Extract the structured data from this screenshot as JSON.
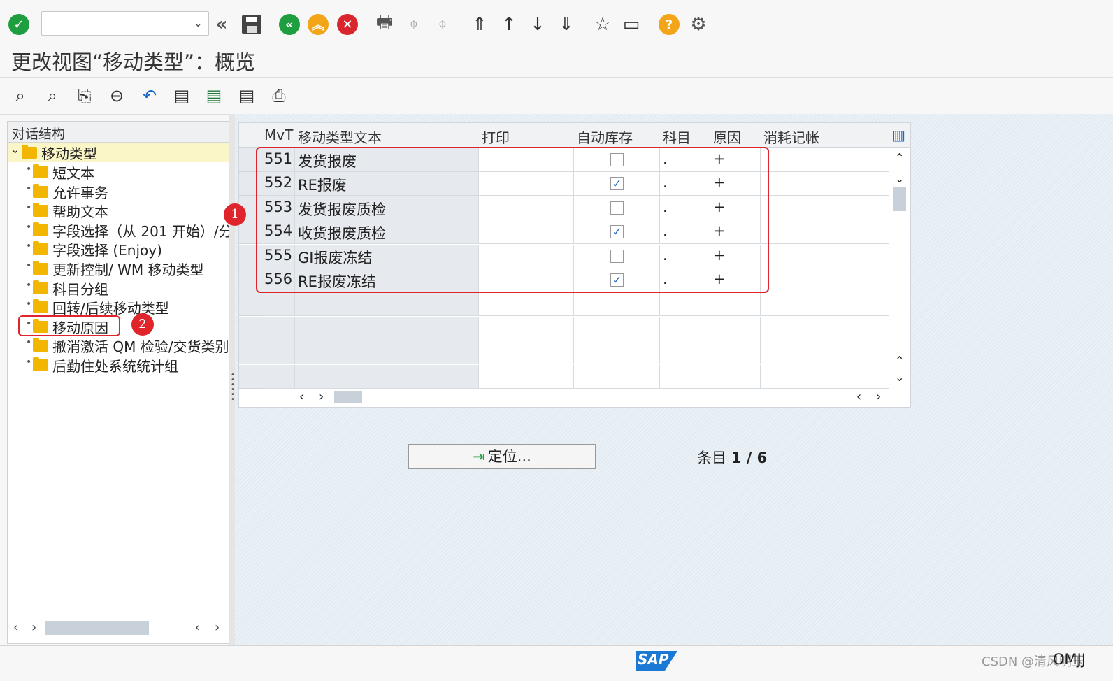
{
  "toolbar": {
    "command_field_value": "",
    "icons": [
      "enter-icon",
      "back-double-icon",
      "save-icon",
      "back-icon",
      "exit-icon",
      "cancel-icon",
      "print-icon",
      "find-icon",
      "find-next-icon",
      "first-page-icon",
      "prev-page-icon",
      "next-page-icon",
      "last-page-icon",
      "new-session-icon",
      "shortcut-icon",
      "help-icon",
      "settings-icon"
    ]
  },
  "page": {
    "title": "更改视图“移动类型”：概览"
  },
  "app_toolbar": {
    "icons": [
      "display-change-icon",
      "details-icon",
      "copy-as-icon",
      "delete-icon",
      "undo-icon",
      "select-all-icon",
      "select-block-icon",
      "deselect-all-icon",
      "print-standard-list-icon"
    ]
  },
  "tree": {
    "header": "对话结构",
    "root": "移动类型",
    "items": [
      "短文本",
      "允许事务",
      "帮助文本",
      "字段选择（从 201 开始）/分",
      "字段选择 (Enjoy)",
      "更新控制/ WM 移动类型",
      "科目分组",
      "回转/后续移动类型",
      "移动原因",
      "撤消激活 QM 检验/交货类别",
      "后勤住处系统统计组"
    ]
  },
  "table": {
    "columns": [
      "MvT",
      "移动类型文本",
      "打印",
      "自动库存",
      "科目",
      "原因",
      "消耗记帐"
    ],
    "rows": [
      {
        "mvt": "551",
        "text": "发货报废",
        "print": "",
        "auto": false,
        "acct": ".",
        "reason": "+",
        "cons": ""
      },
      {
        "mvt": "552",
        "text": "RE报废",
        "print": "",
        "auto": true,
        "acct": ".",
        "reason": "+",
        "cons": ""
      },
      {
        "mvt": "553",
        "text": "发货报废质检",
        "print": "",
        "auto": false,
        "acct": ".",
        "reason": "+",
        "cons": ""
      },
      {
        "mvt": "554",
        "text": "收货报废质检",
        "print": "",
        "auto": true,
        "acct": ".",
        "reason": "+",
        "cons": ""
      },
      {
        "mvt": "555",
        "text": "GI报废冻结",
        "print": "",
        "auto": false,
        "acct": ".",
        "reason": "+",
        "cons": ""
      },
      {
        "mvt": "556",
        "text": "RE报废冻结",
        "print": "",
        "auto": true,
        "acct": ".",
        "reason": "+",
        "cons": ""
      }
    ]
  },
  "annotations": {
    "badge1": "1",
    "badge2": "2"
  },
  "position_button": "定位...",
  "entries": {
    "label": "条目",
    "value": "1 / 6"
  },
  "status": {
    "logo": "SAP",
    "transaction": "OMJJ",
    "watermark": "CSDN @清风明玉"
  },
  "colors": {
    "accent_red": "#e0242b",
    "sap_blue": "#1a79d4",
    "folder": "#f2b600"
  }
}
